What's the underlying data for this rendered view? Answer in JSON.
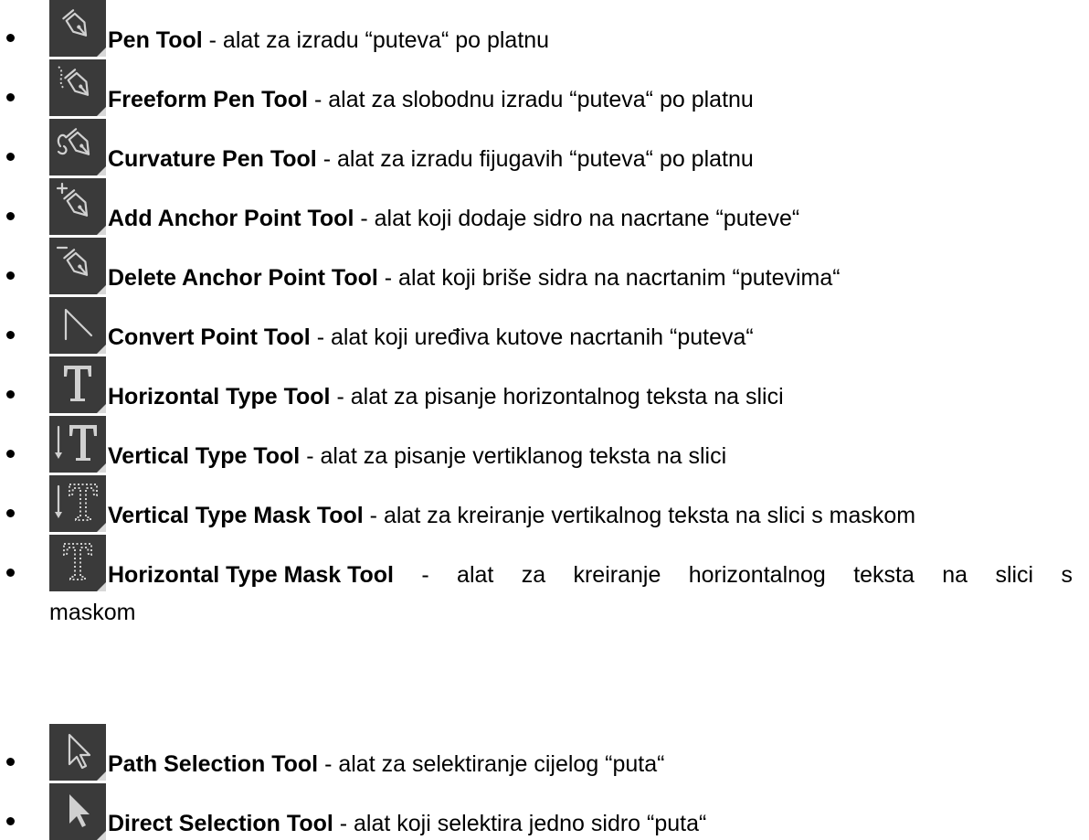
{
  "items": [
    {
      "icon": "pen-icon",
      "name": "Pen Tool",
      "desc": " - alat za izradu “puteva“ po platnu"
    },
    {
      "icon": "freeform-pen-icon",
      "name": "Freeform Pen Tool",
      "desc": " - alat za slobodnu izradu “puteva“ po platnu"
    },
    {
      "icon": "curvature-pen-icon",
      "name": "Curvature Pen Tool",
      "desc": " - alat za izradu fijugavih “puteva“ po platnu"
    },
    {
      "icon": "add-anchor-point-icon",
      "name": "Add Anchor Point Tool",
      "desc": " - alat koji dodaje sidro na nacrtane “puteve“"
    },
    {
      "icon": "delete-anchor-point-icon",
      "name": "Delete Anchor Point Tool",
      "desc": " - alat koji briše sidra na nacrtanim “putevima“"
    },
    {
      "icon": "convert-point-icon",
      "name": "Convert Point Tool",
      "desc": " - alat koji uređiva kutove nacrtanih “puteva“"
    },
    {
      "icon": "horizontal-type-icon",
      "name": "Horizontal Type Tool",
      "desc": " - alat za pisanje horizontalnog teksta na slici"
    },
    {
      "icon": "vertical-type-icon",
      "name": "Vertical Type Tool",
      "desc": " - alat za pisanje vertiklanog teksta na slici"
    },
    {
      "icon": "vertical-type-mask-icon",
      "name": "Vertical Type Mask Tool",
      "desc": " - alat za kreiranje vertikalnog teksta na slici s maskom"
    },
    {
      "icon": "horizontal-type-mask-icon",
      "name": "Horizontal Type Mask Tool",
      "desc_words": [
        "-",
        "alat",
        "za",
        "kreiranje",
        "horizontalnog",
        "teksta",
        "na",
        "slici",
        "s"
      ],
      "desc_wrap": "maskom"
    },
    {
      "icon": "path-selection-icon",
      "name": "Path Selection Tool",
      "desc": " - alat za selektiranje cijelog “puta“"
    },
    {
      "icon": "direct-selection-icon",
      "name": "Direct Selection Tool",
      "desc": " - alat koji selektira jedno sidro “puta“"
    }
  ]
}
